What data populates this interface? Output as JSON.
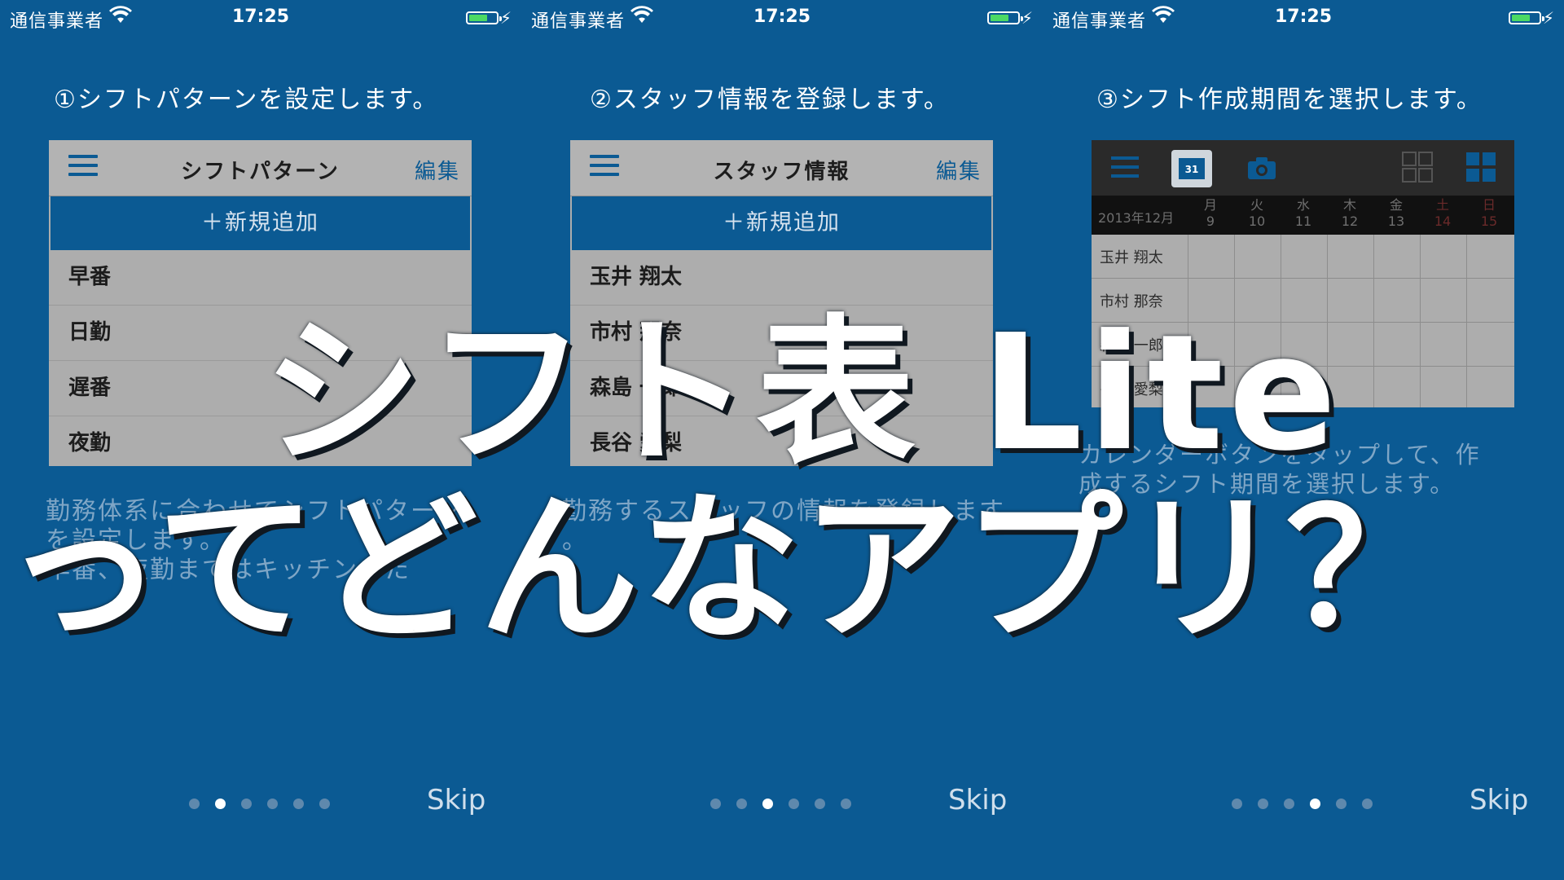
{
  "status_bar": {
    "carrier": "通信事業者",
    "time": "17:25"
  },
  "panels": [
    {
      "heading": "①シフトパターンを設定します。",
      "card_title": "シフトパターン",
      "edit_label": "編集",
      "add_label": "＋新規追加",
      "rows": [
        "早番",
        "日勤",
        "遅番",
        "夜勤"
      ],
      "description": [
        "勤務体系に合わせてシフトパターン",
        "を設定します。",
        "早番、夜勤まではキッチンまた"
      ],
      "skip_label": "Skip",
      "active_dot": 1
    },
    {
      "heading": "②スタッフ情報を登録します。",
      "card_title": "スタッフ情報",
      "edit_label": "編集",
      "add_label": "＋新規追加",
      "rows": [
        "玉井 翔太",
        "市村 那奈",
        "森島 一郎",
        "長谷 愛梨"
      ],
      "description": [
        "勤務するスタッフの情報を登録します",
        "。"
      ],
      "skip_label": "Skip",
      "active_dot": 2
    },
    {
      "heading": "③シフト作成期間を選択します。",
      "calendar": {
        "button_day": "31",
        "month": "2013年12月",
        "days": [
          {
            "dow": "月",
            "d": "9"
          },
          {
            "dow": "火",
            "d": "10"
          },
          {
            "dow": "水",
            "d": "11"
          },
          {
            "dow": "木",
            "d": "12"
          },
          {
            "dow": "金",
            "d": "13"
          },
          {
            "dow": "土",
            "d": "14"
          },
          {
            "dow": "日",
            "d": "15"
          }
        ],
        "names": [
          "玉井 翔太",
          "市村 那奈",
          "森島 一郎",
          "長谷 愛梨"
        ]
      },
      "description": [
        "カレンダーボタンをタップして、作",
        "成するシフト期間を選択します。"
      ],
      "skip_label": "Skip",
      "active_dot": 3
    }
  ],
  "overlay": {
    "line1": "シフト表 Lite",
    "line2": "ってどんなアプリ？"
  },
  "colors": {
    "background": "#0b5a93",
    "card": "#adadad",
    "accent": "#0b5a93",
    "battery": "#4cd964"
  }
}
